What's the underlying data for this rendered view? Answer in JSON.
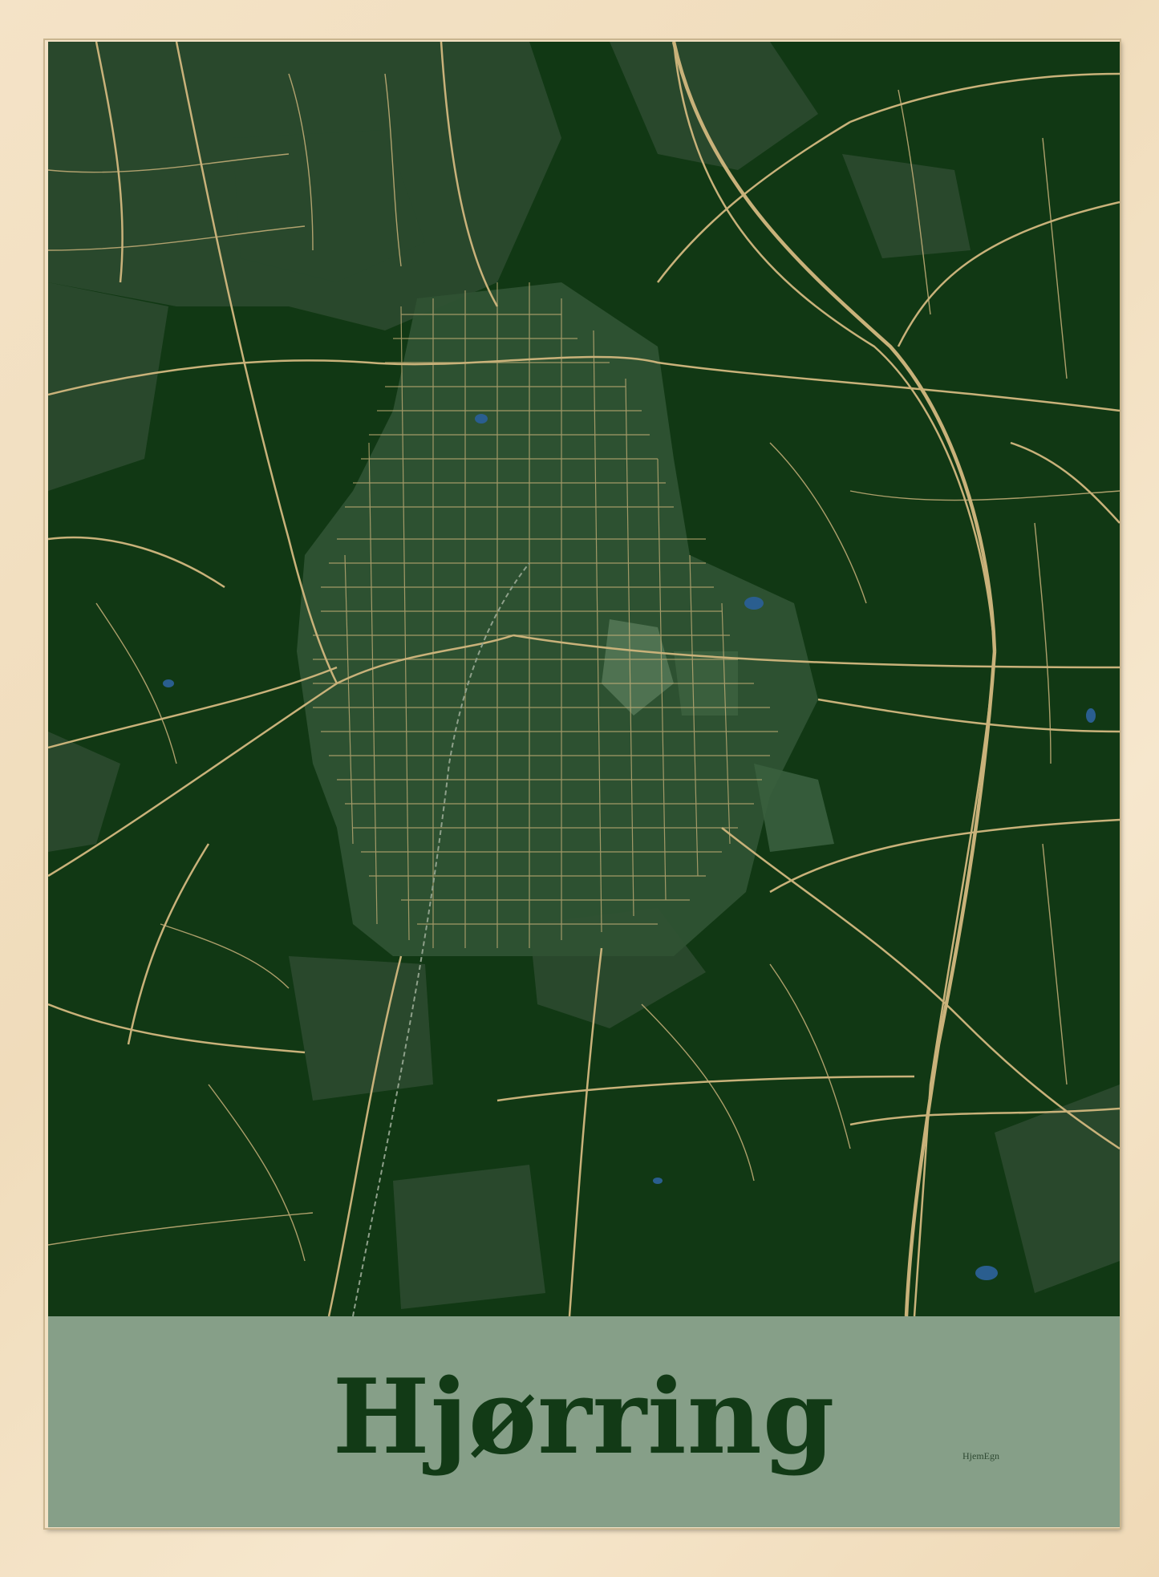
{
  "poster": {
    "city_name": "Hjørring",
    "brand_mark": "HjemEgn"
  },
  "colors": {
    "frame_wood": "#f2dfc0",
    "map_background": "#113814",
    "land_patch": "#2c4a2f",
    "roads": "#c9b27a",
    "water": "#2a5e8f",
    "title_band": "#cfded0",
    "title_text": "#123a16"
  },
  "map_features": [
    "roads",
    "motorway",
    "railway",
    "urban-area",
    "fields",
    "lakes"
  ]
}
